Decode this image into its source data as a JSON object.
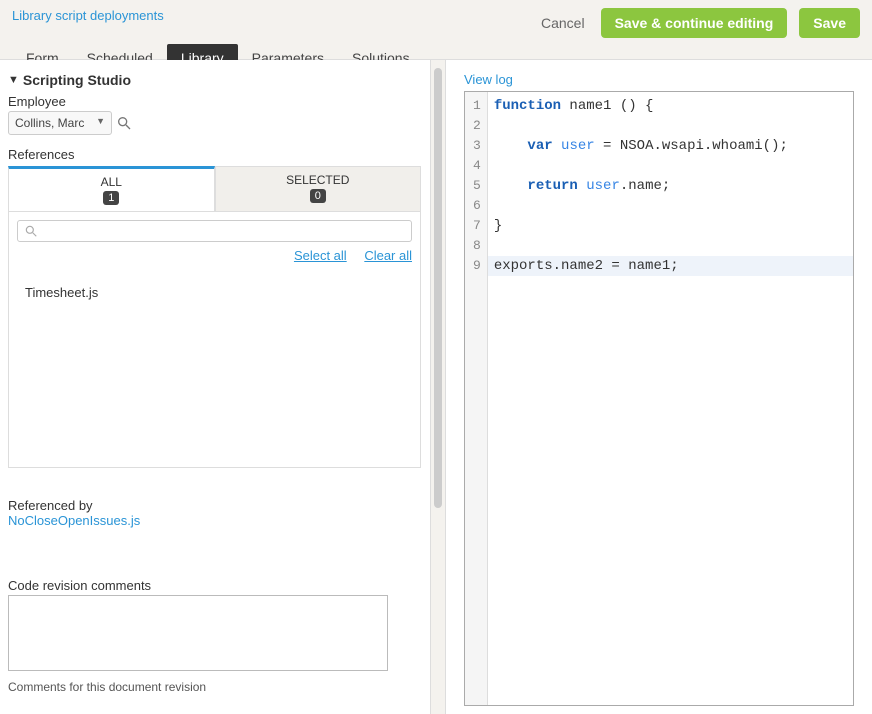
{
  "header": {
    "breadcrumb": "Library script deployments",
    "tabs": [
      "Form",
      "Scheduled",
      "Library",
      "Parameters",
      "Solutions"
    ],
    "active_tab_index": 2,
    "actions": {
      "cancel": "Cancel",
      "save_continue": "Save & continue editing",
      "save": "Save"
    }
  },
  "left": {
    "section_title": "Scripting Studio",
    "employee_label": "Employee",
    "employee_value": "Collins, Marc",
    "references_label": "References",
    "ref_tabs": {
      "all_label": "ALL",
      "all_count": "1",
      "selected_label": "SELECTED",
      "selected_count": "0"
    },
    "ref_links": {
      "select_all": "Select all",
      "clear_all": "Clear all"
    },
    "ref_items": [
      "Timesheet.js"
    ],
    "referenced_by_label": "Referenced by",
    "referenced_by_link": "NoCloseOpenIssues.js",
    "comments_label": "Code revision comments",
    "comments_hint": "Comments for this document revision"
  },
  "right": {
    "view_log": "View log",
    "code": {
      "line_numbers": [
        "1",
        "2",
        "3",
        "4",
        "5",
        "6",
        "7",
        "8",
        "9"
      ],
      "l1_kw1": "function",
      "l1_rest": " name1 () {",
      "l3_kw1": "var",
      "l3_var": " user",
      "l3_rest": " = NSOA.wsapi.whoami();",
      "l5_kw1": "return",
      "l5_var": " user",
      "l5_rest": ".name;",
      "l7": "}",
      "l9": "exports.name2 = name1;"
    }
  }
}
